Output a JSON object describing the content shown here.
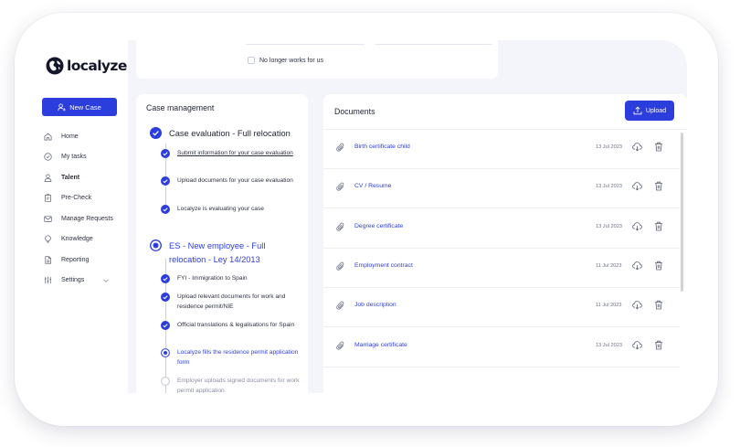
{
  "brand": {
    "name": "localyze",
    "color": "#2c3ddd"
  },
  "sidebar": {
    "new_case_label": "New Case",
    "items": [
      {
        "label": "Home",
        "icon": "home-icon"
      },
      {
        "label": "My tasks",
        "icon": "check-circle-icon"
      },
      {
        "label": "Talent",
        "icon": "user-icon",
        "active": true
      },
      {
        "label": "Pre-Check",
        "icon": "clipboard-icon"
      },
      {
        "label": "Manage Requests",
        "icon": "mail-icon"
      },
      {
        "label": "Knowledge",
        "icon": "lightbulb-icon"
      },
      {
        "label": "Reporting",
        "icon": "document-icon"
      },
      {
        "label": "Settings",
        "icon": "sliders-icon",
        "expandable": true
      }
    ]
  },
  "top_card": {
    "checkbox_label": "No longer works for us",
    "checked": false
  },
  "case_management": {
    "title": "Case management",
    "phases": [
      {
        "title": "Case evaluation - Full relocation",
        "status": "completed",
        "steps": [
          {
            "label": "Submit information for your case evaluation",
            "status": "completed",
            "link": true
          },
          {
            "label": "Upload documents for your case evaluation",
            "status": "completed"
          },
          {
            "label": "Localyze is evaluating your case",
            "status": "completed"
          }
        ]
      },
      {
        "title": "ES - New employee - Full relocation - Ley 14/2013",
        "status": "in-progress",
        "steps": [
          {
            "label": "FYI - Immigration to Spain",
            "status": "completed"
          },
          {
            "label": "Upload relevant documents for work and residence permit/NIE",
            "status": "completed"
          },
          {
            "label": "Official translations & legalisations for Spain",
            "status": "completed"
          },
          {
            "label": "Localyze fills the residence permit application form",
            "status": "current"
          },
          {
            "label": "Employer uploads signed documents for work permit application",
            "status": "pending"
          }
        ]
      }
    ]
  },
  "documents": {
    "title": "Documents",
    "upload_label": "Upload",
    "items": [
      {
        "name": "Birth certificate child",
        "date": "13 Jul 2023"
      },
      {
        "name": "CV / Resume",
        "date": "13 Jul 2023"
      },
      {
        "name": "Degree certificate",
        "date": "13 Jul 2023"
      },
      {
        "name": "Employment contract",
        "date": "11 Jul 2023"
      },
      {
        "name": "Job description",
        "date": "11 Jul 2023"
      },
      {
        "name": "Marriage certificate",
        "date": "13 Jul 2023"
      }
    ]
  }
}
